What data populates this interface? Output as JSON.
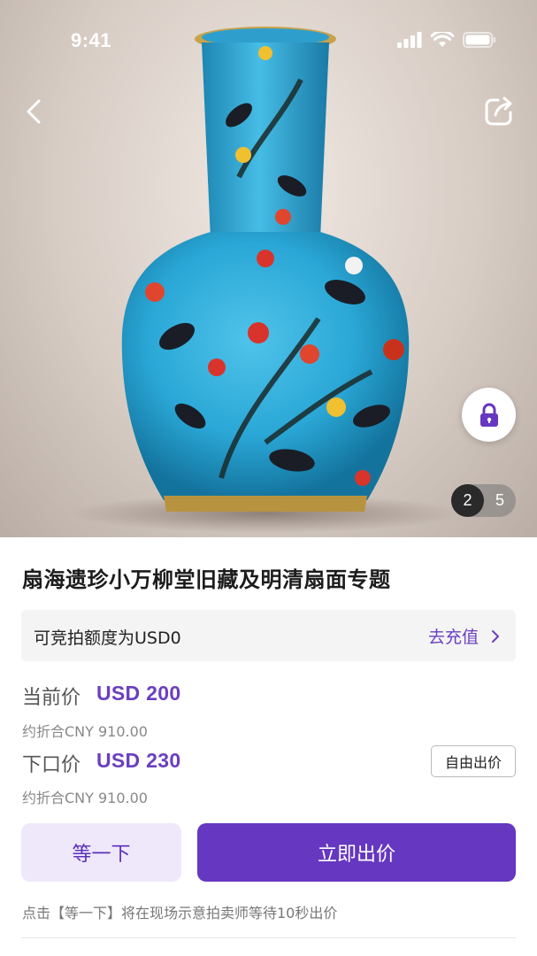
{
  "status_bar": {
    "time": "9:41"
  },
  "gallery": {
    "current_page": "2",
    "total_pages": "5"
  },
  "title": "扇海遗珍小万柳堂旧藏及明清扇面专题",
  "credit": {
    "text": "可竞拍额度为USD0",
    "link_label": "去充值"
  },
  "current_price": {
    "label": "当前价",
    "value": "USD 200",
    "converted": "约折合CNY 910.00"
  },
  "next_price": {
    "label": "下口价",
    "value": "USD 230",
    "converted": "约折合CNY 910.00"
  },
  "free_bid_label": "自由出价",
  "buttons": {
    "wait": "等一下",
    "bid_now": "立即出价"
  },
  "hint": "点击【等一下】将在现场示意拍卖师等待10秒出价",
  "colors": {
    "accent": "#6637c0",
    "accent_light": "#efe8fb"
  },
  "icons": [
    "back-icon",
    "share-icon",
    "lock-icon",
    "signal-icon",
    "wifi-icon",
    "battery-icon",
    "chevron-right-icon"
  ]
}
